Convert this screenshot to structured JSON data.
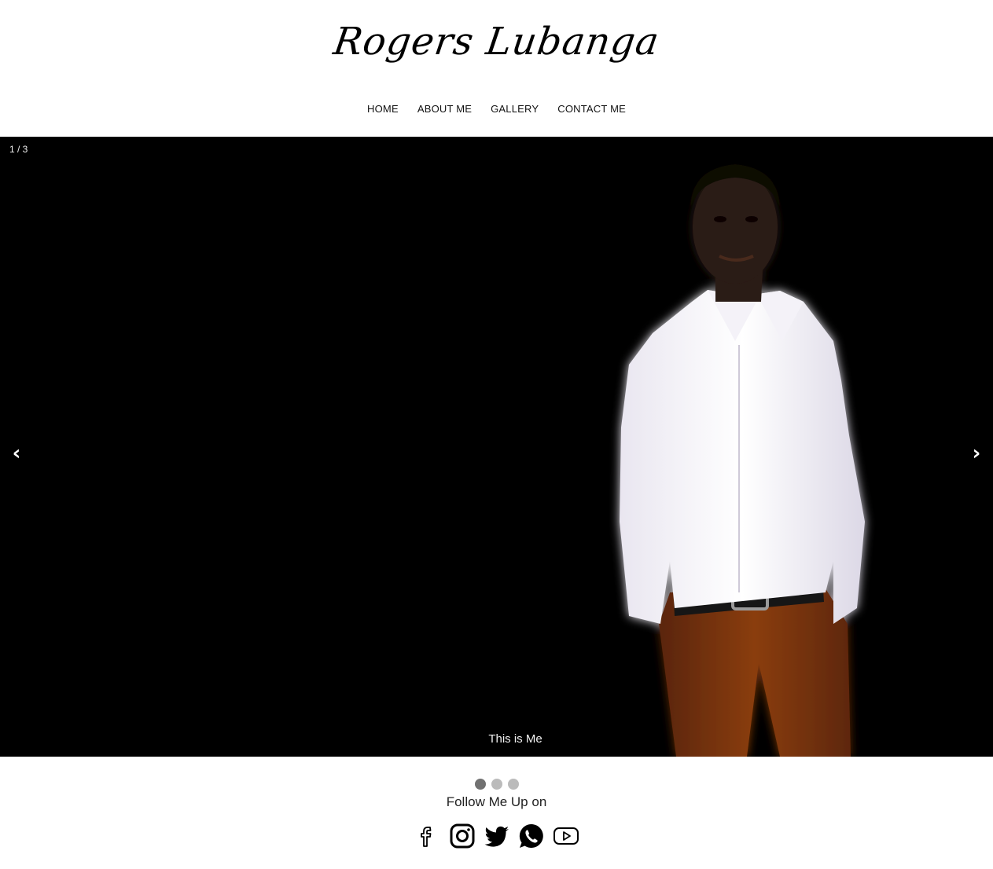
{
  "header": {
    "logo_text": "Rogers Lubanga"
  },
  "nav": {
    "items": [
      {
        "label": "HOME"
      },
      {
        "label": "ABOUT ME"
      },
      {
        "label": "GALLERY"
      },
      {
        "label": "CONTACT ME"
      }
    ]
  },
  "slideshow": {
    "counter": "1 / 3",
    "prev_icon": "‹",
    "next_icon": "›",
    "caption": "This is Me",
    "current_slide": 1,
    "total_slides": 3,
    "background_color": "#000000"
  },
  "follow": {
    "label": "Follow Me Up on",
    "icons": [
      "facebook-icon",
      "instagram-icon",
      "twitter-icon",
      "whatsapp-icon",
      "youtube-icon"
    ]
  },
  "colors": {
    "dot_active": "#717171",
    "dot_inactive": "#bbbbbb"
  }
}
